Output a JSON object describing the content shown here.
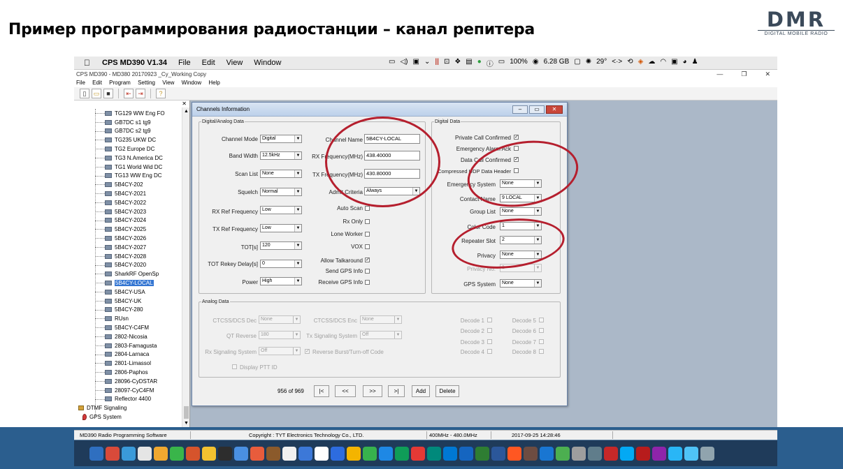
{
  "slide": {
    "title": "Пример программирования радиостанции – канал репитера",
    "logo_big": "DMR",
    "logo_small": "DIGITAL MOBILE RADIO"
  },
  "mac_menubar": {
    "apple": "",
    "app_name": "CPS MD390 V1.34",
    "menus": [
      "File",
      "Edit",
      "View",
      "Window"
    ],
    "battery": "100%",
    "memory": "6.28 GB",
    "temperature": "29°"
  },
  "window": {
    "title": "CPS MD390 - MD380 20170923 _Cy_Working Copy",
    "menus": [
      "File",
      "Edit",
      "Program",
      "Setting",
      "View",
      "Window",
      "Help"
    ],
    "minimize": "—",
    "maximize": "❐",
    "close": "✕"
  },
  "tree": {
    "items": [
      "TG129 WW Eng  FO",
      "GB7DC s1 tg9",
      "GB7DC s2 tg9",
      "TG235 UKW   DC",
      "TG2 Europe   DC",
      "TG3 N.America DC",
      "TG1 World Wid DC",
      "TG13 WW Eng   DC",
      "5B4CY-202",
      "5B4CY-2021",
      "5B4CY-2022",
      "5B4CY-2023",
      "5B4CY-2024",
      "5B4CY-2025",
      "5B4CY-2026",
      "5B4CY-2027",
      "5B4CY-2028",
      "5B4CY-2020",
      "SharkRF OpenSp",
      "5B4CY-LOCAL",
      "5B4CY-USA",
      "5B4CY-UK",
      "5B4CY-280",
      "RUsn",
      "5B4CY-C4FM",
      "2802-Nicosia",
      "2803-Famagusta",
      "2804-Larnaca",
      "2801-Limassol",
      "2806-Paphos",
      "28096-CyDSTAR",
      "28097-CyC4FM",
      "Reflector 4400"
    ],
    "selected_index": 19,
    "dtmf": "DTMF Signaling",
    "gps": "GPS System"
  },
  "dialog": {
    "title": "Channels Information",
    "digital_analog_legend": "Digital/Analog Data",
    "digital_legend": "Digital Data",
    "analog_legend": "Analog Data",
    "fields": {
      "channel_mode_label": "Channel Mode",
      "channel_mode": "Digital",
      "bandwidth_label": "Band Width",
      "bandwidth": "12.5kHz",
      "scan_list_label": "Scan List",
      "scan_list": "None",
      "squelch_label": "Squelch",
      "squelch": "Normal",
      "rx_ref_label": "RX Ref Frequency",
      "rx_ref": "Low",
      "tx_ref_label": "TX Ref Frequency",
      "tx_ref": "Low",
      "tot_label": "TOT[s]",
      "tot": "120",
      "tot_rekey_label": "TOT Rekey Delay[s]",
      "tot_rekey": "0",
      "power_label": "Power",
      "power": "High",
      "channel_name_label": "Channel Name",
      "channel_name": "5B4CY-LOCAL",
      "rx_freq_label": "RX Frequency(MHz)",
      "rx_freq": "438.40000",
      "tx_freq_label": "TX Frequency(MHz)",
      "tx_freq": "430.80000",
      "admit_label": "Admit Criteria",
      "admit": "Always",
      "auto_scan_label": "Auto Scan",
      "rx_only_label": "Rx Only",
      "lone_worker_label": "Lone Worker",
      "vox_label": "VOX",
      "allow_talkaround_label": "Allow Talkaround",
      "send_gps_label": "Send GPS Info",
      "receive_gps_label": "Receive GPS Info",
      "private_call_label": "Private Call Confirmed",
      "emergency_alarm_label": "Emergency Alarm Ack",
      "data_call_label": "Data Call Confirmed",
      "compressed_udp_label": "Compressed UDP Data Header",
      "emergency_system_label": "Emergency System",
      "emergency_system": "None",
      "contact_name_label": "Contact Name",
      "contact_name": "9 LOCAL",
      "group_list_label": "Group List",
      "group_list": "None",
      "color_code_label": "Color Code",
      "color_code": "1",
      "repeater_slot_label": "Repeater Slot",
      "repeater_slot": "2",
      "privacy_label": "Privacy",
      "privacy": "None",
      "privacy_no_label": "Privacy No.",
      "privacy_no": "1",
      "gps_system_label": "GPS System",
      "gps_system": "None",
      "ctcss_dec_label": "CTCSS/DCS Dec",
      "ctcss_dec": "None",
      "ctcss_enc_label": "CTCSS/DCS Enc",
      "ctcss_enc": "None",
      "qt_reverse_label": "QT Reverse",
      "qt_reverse": "180",
      "tx_signal_label": "Tx Signaling System",
      "tx_signal": "Off",
      "rx_signal_label": "Rx Signaling System",
      "rx_signal": "Off",
      "reverse_burst_label": "Reverse Burst/Turn-off Code",
      "display_ptt_label": "Display PTT ID",
      "decode_labels": [
        "Decode 1",
        "Decode 5",
        "Decode 2",
        "Decode 6",
        "Decode 3",
        "Decode 7",
        "Decode 4",
        "Decode 8"
      ]
    },
    "nav": {
      "count": "956 of 969",
      "first": "|<",
      "prev": "<<",
      "next": ">>",
      "last": ">|",
      "add": "Add",
      "delete": "Delete"
    }
  },
  "statusbar": {
    "app": "MD390 Radio Programming Software",
    "copyright": "Copyright : TYT Electronics Technology Co., LTD.",
    "band": "400MHz - 480.0MHz",
    "datetime": "2017-09-25 14:28:46"
  },
  "colors": {
    "highlight_oval": "#b51f2e",
    "selected_item": "#3476d2",
    "slide_band": "#2b5e8e",
    "workarea": "#abb8c8"
  }
}
